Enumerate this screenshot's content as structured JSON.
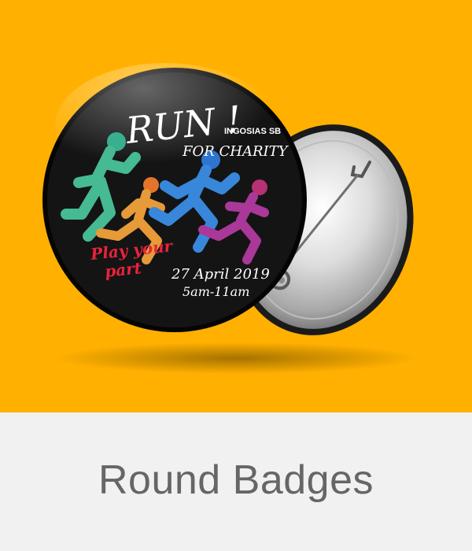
{
  "badge": {
    "title": "RUN !",
    "subtitle": "FOR CHARITY",
    "organizer": "INGOSIAS SB",
    "slogan_line1": "Play your",
    "slogan_line2": "part",
    "date": "27 April 2019",
    "time": "5am-11am"
  },
  "caption": {
    "label": "Round Badges"
  },
  "colors": {
    "background": "#ffb000",
    "caption_bg": "#f1f1f1",
    "caption_text": "#666666",
    "badge_face": "#111111",
    "slogan": "#e8233b"
  }
}
